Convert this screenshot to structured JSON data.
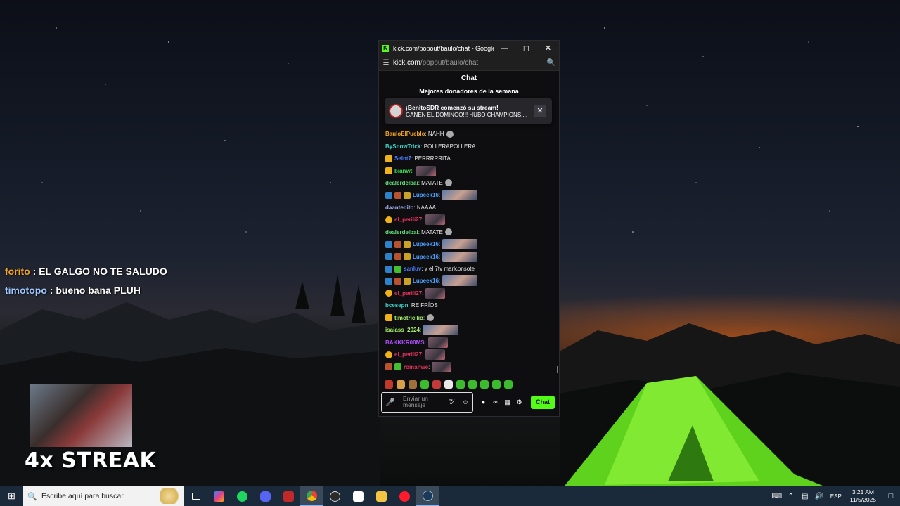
{
  "overlay": {
    "line1_user": "forito",
    "line1_text": " : EL GALGO NO TE SALUDO",
    "line2_user": "timotopo",
    "line2_text": " : bueno bana PLUH",
    "streak": "4x STREAK"
  },
  "window": {
    "title": "kick.com/popout/baulo/chat - Google C...",
    "url_host": "kick.com",
    "url_path": "/popout/baulo/chat",
    "chat_header": "Chat",
    "donors_title": "Mejores donadores de la semana",
    "notification": {
      "title": "¡BenitoSDR comenzó su stream!",
      "body": "GANEN EL DOMINGO!!! HUBO CHAMPIONS...."
    },
    "messages": [
      {
        "user": "BauloElPueblo",
        "color": "#f5a623",
        "text": ": NAHH",
        "badges": [],
        "emote": "sm"
      },
      {
        "user": "BySnowTrick",
        "color": "#3fd0c9",
        "text": ": POLLERAPOLLERA",
        "badges": [],
        "emote": ""
      },
      {
        "user": "Seint7",
        "color": "#4a7fff",
        "text": ": PERRRRRITA",
        "badges": [
          "b-crown"
        ],
        "emote": ""
      },
      {
        "user": "bianwt",
        "color": "#3fdc5a",
        "text": ":",
        "badges": [
          "b-crown"
        ],
        "emote": "normal"
      },
      {
        "user": "dealerdelbai",
        "color": "#62e07a",
        "text": ": MATATE",
        "badges": [],
        "emote": "sm"
      },
      {
        "user": "Lupeek16",
        "color": "#4a9fff",
        "text": ":",
        "badges": [
          "b-blue",
          "b-red",
          "b-gold"
        ],
        "emote": "wide"
      },
      {
        "user": "daantedito",
        "color": "#a9b8ff",
        "text": ": NAAAA",
        "badges": [],
        "emote": ""
      },
      {
        "user": "el_perili27",
        "color": "#e0335a",
        "text": ":",
        "badges": [
          "b-coin"
        ],
        "emote": "normal"
      },
      {
        "user": "dealerdelbai",
        "color": "#62e07a",
        "text": ": MATATE",
        "badges": [],
        "emote": "sm"
      },
      {
        "user": "Lupeek16",
        "color": "#4a9fff",
        "text": ":",
        "badges": [
          "b-blue",
          "b-red",
          "b-gold"
        ],
        "emote": "wide"
      },
      {
        "user": "Lupeek16",
        "color": "#4a9fff",
        "text": ":",
        "badges": [
          "b-blue",
          "b-red",
          "b-gold"
        ],
        "emote": "wide"
      },
      {
        "user": "sanluv",
        "color": "#4a7fff",
        "text": ": y el 7tv marlconsote",
        "badges": [
          "b-blue",
          "b-green"
        ],
        "emote": ""
      },
      {
        "user": "Lupeek16",
        "color": "#4a9fff",
        "text": ":",
        "badges": [
          "b-blue",
          "b-red",
          "b-gold"
        ],
        "emote": "wide"
      },
      {
        "user": "el_perili27",
        "color": "#e0335a",
        "text": ":",
        "badges": [
          "b-coin"
        ],
        "emote": "normal"
      },
      {
        "user": "bcesepn",
        "color": "#3fd0c9",
        "text": ": RE FRÍOS",
        "badges": [],
        "emote": ""
      },
      {
        "user": "timotricilio",
        "color": "#a7f06a",
        "text": ":",
        "badges": [
          "b-crown"
        ],
        "emote": "sm"
      },
      {
        "user": "isaiass_2024",
        "color": "#a7f06a",
        "text": ":",
        "badges": [],
        "emote": "wide"
      },
      {
        "user": "BAKKKR00MS",
        "color": "#b04fff",
        "text": ":",
        "badges": [],
        "emote": "normal"
      },
      {
        "user": "el_perili27",
        "color": "#e0335a",
        "text": ":",
        "badges": [
          "b-coin"
        ],
        "emote": "normal"
      },
      {
        "user": "romanwe",
        "color": "#e0335a",
        "text": ":",
        "badges": [
          "b-red",
          "b-green"
        ],
        "emote": "normal"
      }
    ],
    "input_placeholder": "Enviar un mensaje",
    "send_label": "Chat"
  },
  "taskbar": {
    "search_placeholder": "Escribe aquí para buscar",
    "lang": "ESP",
    "time": "3:21 AM",
    "date": "11/5/2025"
  },
  "colors": {
    "kick_green": "#53fc18",
    "taskbar_bg": "#1b2a3a"
  }
}
